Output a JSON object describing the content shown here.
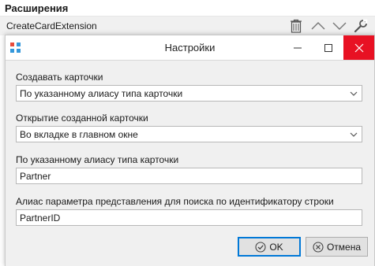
{
  "section": {
    "title": "Расширения"
  },
  "extension": {
    "name": "CreateCardExtension",
    "icons": [
      "trash-icon",
      "chevron-up-icon",
      "chevron-down-icon",
      "wrench-icon"
    ]
  },
  "dialog": {
    "title": "Настройки",
    "window_buttons": [
      "minimize-icon",
      "maximize-icon",
      "close-icon"
    ],
    "fields": [
      {
        "label": "Создавать карточки",
        "value": "По указанному алиасу типа карточки",
        "type": "select"
      },
      {
        "label": "Открытие созданной карточки",
        "value": "Во вкладке в главном окне",
        "type": "select"
      },
      {
        "label": "По указанному алиасу типа карточки",
        "value": "Partner",
        "type": "text"
      },
      {
        "label": "Алиас параметра представления для поиска по идентификатору строки",
        "value": "PartnerID",
        "type": "text"
      }
    ],
    "buttons": {
      "ok": "OK",
      "cancel": "Отмена"
    }
  },
  "colors": {
    "close_button": "#e81123",
    "ok_border": "#0078d7",
    "panel_bg": "#f0f0f0"
  }
}
